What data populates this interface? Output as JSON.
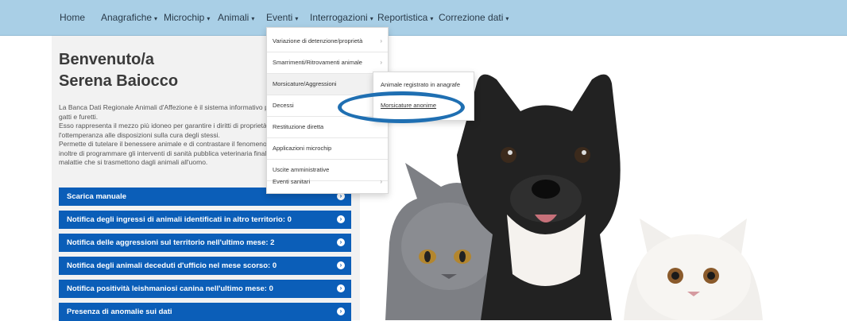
{
  "nav": {
    "items": [
      {
        "label": "Home",
        "caret": ""
      },
      {
        "label": "Anagrafiche",
        "caret": "▾"
      },
      {
        "label": "Microchip",
        "caret": "▾"
      },
      {
        "label": "Animali",
        "caret": "▾"
      },
      {
        "label": "Eventi",
        "caret": "▾"
      },
      {
        "label": "Interrogazioni",
        "caret": "▾"
      },
      {
        "label": "Reportistica",
        "caret": "▾"
      },
      {
        "label": "Correzione dati",
        "caret": "▾"
      }
    ]
  },
  "welcome": {
    "line1": "Benvenuto/a",
    "line2": "Serena Baiocco"
  },
  "intro": {
    "lines": [
      "La Banca Dati Regionale Animali d'Affezione è il sistema informativo p",
      "gatti e furetti.",
      "Esso rappresenta il mezzo più idoneo per garantire i diritti di proprietà",
      "l'ottemperanza alle disposizioni sulla cura degli stessi.",
      "Permette di tutelare il benessere animale e di contrastare il fenomeno",
      "inoltre di programmare gli interventi di sanità pubblica veterinaria final",
      "malattie che si trasmettono dagli animali all'uomo."
    ]
  },
  "bars": [
    {
      "label": "Scarica manuale"
    },
    {
      "label": "Notifica degli ingressi di animali identificati in altro territorio: 0"
    },
    {
      "label": "Notifica delle aggressioni sul territorio nell'ultimo mese: 2"
    },
    {
      "label": "Notifica degli animali deceduti d'ufficio nel mese scorso: 0"
    },
    {
      "label": "Notifica positività leishmaniosi canina nell'ultimo mese: 0"
    },
    {
      "label": "Presenza di anomalie sui dati"
    }
  ],
  "eventi_menu": {
    "items": [
      {
        "label": "Variazione di detenzione/proprietà",
        "has_sub": true
      },
      {
        "label": "Smarrimenti/Ritrovamenti animale",
        "has_sub": true
      },
      {
        "label": "Morsicature/Aggressioni",
        "has_sub": false
      },
      {
        "label": "Decessi",
        "has_sub": false
      },
      {
        "label": "Restituzione diretta",
        "has_sub": false
      },
      {
        "label": "Applicazioni microchip",
        "has_sub": false
      },
      {
        "label": "Uscite amministrative",
        "has_sub": false
      },
      {
        "label": "Eventi sanitari",
        "has_sub": true
      }
    ],
    "arrow": "›"
  },
  "submenu": {
    "items": [
      {
        "label": "Animale registrato in anagrafe"
      },
      {
        "label": "Morsicature anonime"
      }
    ]
  },
  "colors": {
    "nav_bg": "#a9cfe6",
    "bar_bg": "#0b5eb8",
    "highlight": "#1f6fb2"
  },
  "icons": {
    "bar_chevron": "›",
    "submenu_arrow": "›"
  }
}
